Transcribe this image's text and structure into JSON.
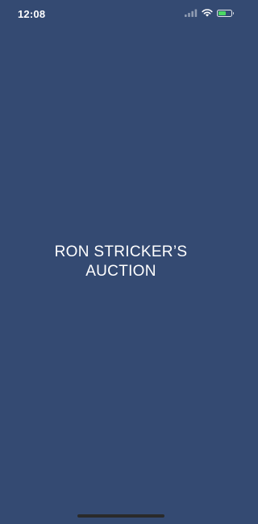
{
  "status_bar": {
    "time": "12:08",
    "icons": [
      "cellular-signal-icon",
      "wifi-icon",
      "battery-charging-icon"
    ],
    "battery_level": 0.6,
    "battery_color": "#4cd964"
  },
  "splash": {
    "title_line_1": "RON STRICKER’S",
    "title_line_2": "AUCTION",
    "background_color": "#344a72"
  }
}
